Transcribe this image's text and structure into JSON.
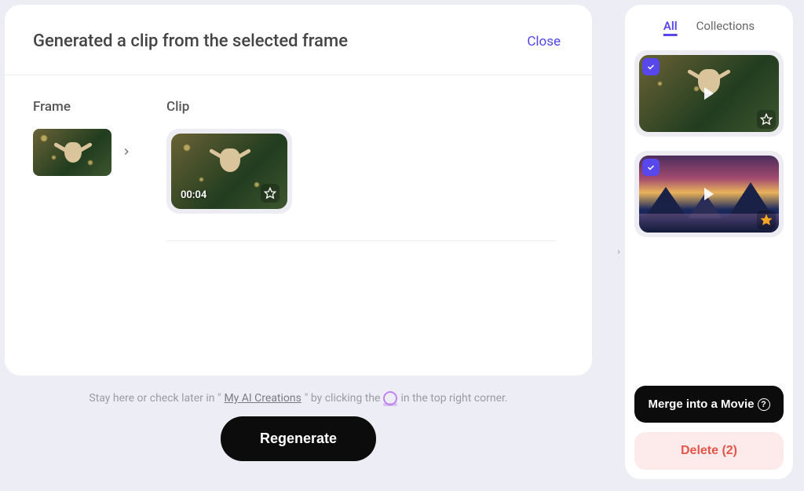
{
  "modal": {
    "title": "Generated a clip from the selected frame",
    "close": "Close",
    "frame_label": "Frame",
    "clip_label": "Clip",
    "clip_duration": "00:04"
  },
  "hint": {
    "pre": "Stay here or check later in \"",
    "link": "My AI Creations",
    "mid": "\"  by clicking the",
    "post": "in the top right corner."
  },
  "buttons": {
    "regenerate": "Regenerate",
    "merge": "Merge into a Movie",
    "delete": "Delete (2)"
  },
  "sidebar": {
    "tabs": {
      "all": "All",
      "collections": "Collections"
    },
    "items": [
      {
        "kind": "cat",
        "selected": true,
        "favorited": false
      },
      {
        "kind": "sunset",
        "selected": true,
        "favorited": true
      }
    ],
    "delete_count": 2
  },
  "icons": {
    "help": "?"
  }
}
